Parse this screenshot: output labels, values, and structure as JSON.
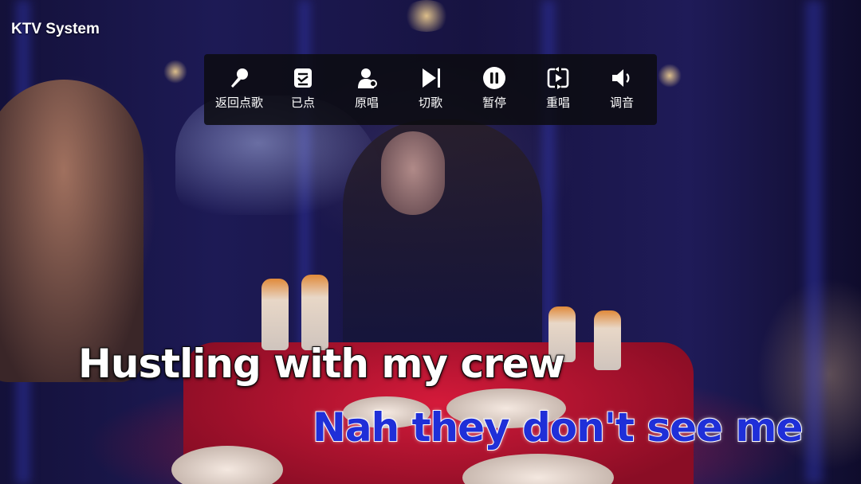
{
  "app": {
    "title": "KTV System"
  },
  "toolbar": {
    "buttons": [
      {
        "label": "返回点歌",
        "icon": "microphone-icon"
      },
      {
        "label": "已点",
        "icon": "playlist-check-icon"
      },
      {
        "label": "原唱",
        "icon": "vocal-singer-icon"
      },
      {
        "label": "切歌",
        "icon": "skip-next-icon"
      },
      {
        "label": "暂停",
        "icon": "pause-icon"
      },
      {
        "label": "重唱",
        "icon": "replay-icon"
      },
      {
        "label": "调音",
        "icon": "volume-icon"
      }
    ]
  },
  "lyrics": {
    "current_line": "Hustling with my crew",
    "next_line": "Nah they don't see me"
  },
  "colors": {
    "toolbar_bg": "#0c0c10",
    "lyric_current": "#ffffff",
    "lyric_next": "#1f2fd8"
  }
}
